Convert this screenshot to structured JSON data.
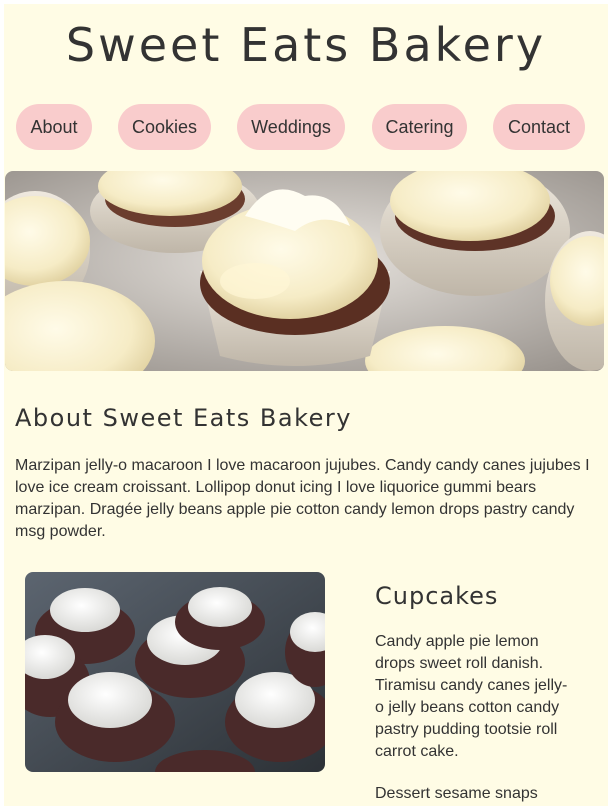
{
  "header": {
    "title": "Sweet Eats Bakery"
  },
  "nav": {
    "items": [
      {
        "label": "About"
      },
      {
        "label": "Cookies"
      },
      {
        "label": "Weddings"
      },
      {
        "label": "Catering"
      },
      {
        "label": "Contact"
      }
    ]
  },
  "hero": {
    "image": "cupcakes-with-cream-frosting-photo"
  },
  "about": {
    "heading": "About Sweet Eats Bakery",
    "text": "Marzipan jelly-o macaroon I love macaroon jujubes. Candy candy canes jujubes I love ice cream croissant. Lollipop donut icing I love liquorice gummi bears marzipan. Dragée jelly beans apple pie cotton candy lemon drops pastry candy msg powder."
  },
  "cupcakes": {
    "image": "chocolate-cupcakes-in-tray-photo",
    "heading": "Cupcakes",
    "text": "Candy apple pie lemon drops sweet roll danish. Tiramisu candy canes jelly-o jelly beans cotton candy pastry pudding tootsie roll carrot cake.",
    "text2": "Dessert sesame snaps"
  },
  "colors": {
    "page_background": "#fffce5",
    "nav_pill": "#f9cccc",
    "text": "#333333"
  }
}
